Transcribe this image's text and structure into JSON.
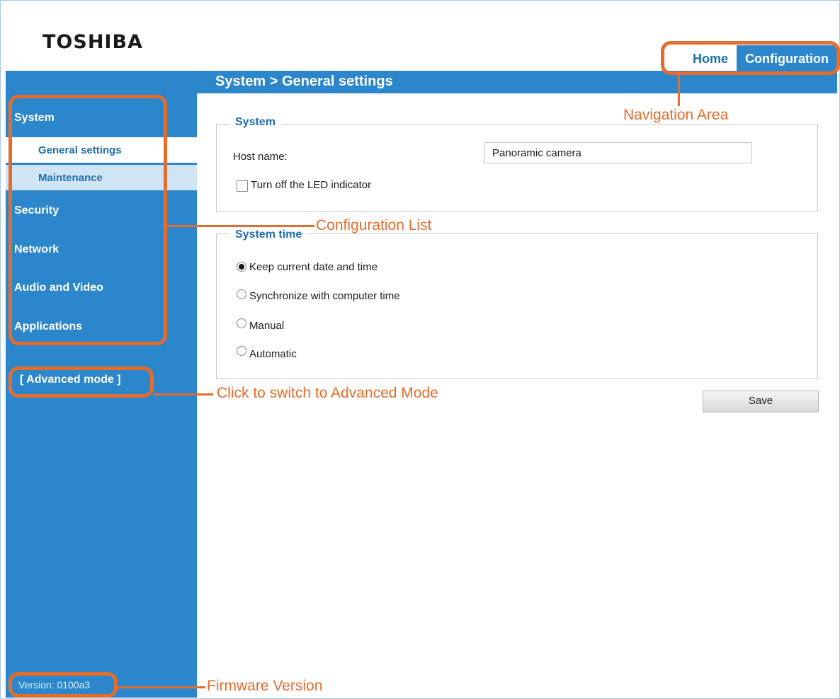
{
  "brand": "TOSHIBA",
  "tabs": {
    "home": "Home",
    "configuration": "Configuration"
  },
  "page_title": "System  > General settings",
  "sidebar": {
    "system": "System",
    "general_settings": "General settings",
    "maintenance": "Maintenance",
    "security": "Security",
    "network": "Network",
    "audio_video": "Audio and Video",
    "applications": "Applications",
    "advanced_mode": "[ Advanced mode ]",
    "version": "Version: 0100a3"
  },
  "system_section": {
    "legend": "System",
    "host_label": "Host name:",
    "host_value": "Panoramic camera",
    "led_label": "Turn off the LED indicator"
  },
  "time_section": {
    "legend": "System time",
    "options": [
      {
        "label": "Keep current date and time",
        "checked": true
      },
      {
        "label": "Synchronize with computer time",
        "checked": false
      },
      {
        "label": "Manual",
        "checked": false
      },
      {
        "label": "Automatic",
        "checked": false
      }
    ]
  },
  "save_label": "Save",
  "annotations": {
    "navigation_area": "Navigation Area",
    "configuration_list": "Configuration List",
    "advanced_switch": "Click to switch to Advanced Mode",
    "firmware_version": "Firmware Version",
    "color": "#e46c2c"
  },
  "colors": {
    "header_blue": "#2b86cc",
    "text_blue": "#1f6faf"
  }
}
